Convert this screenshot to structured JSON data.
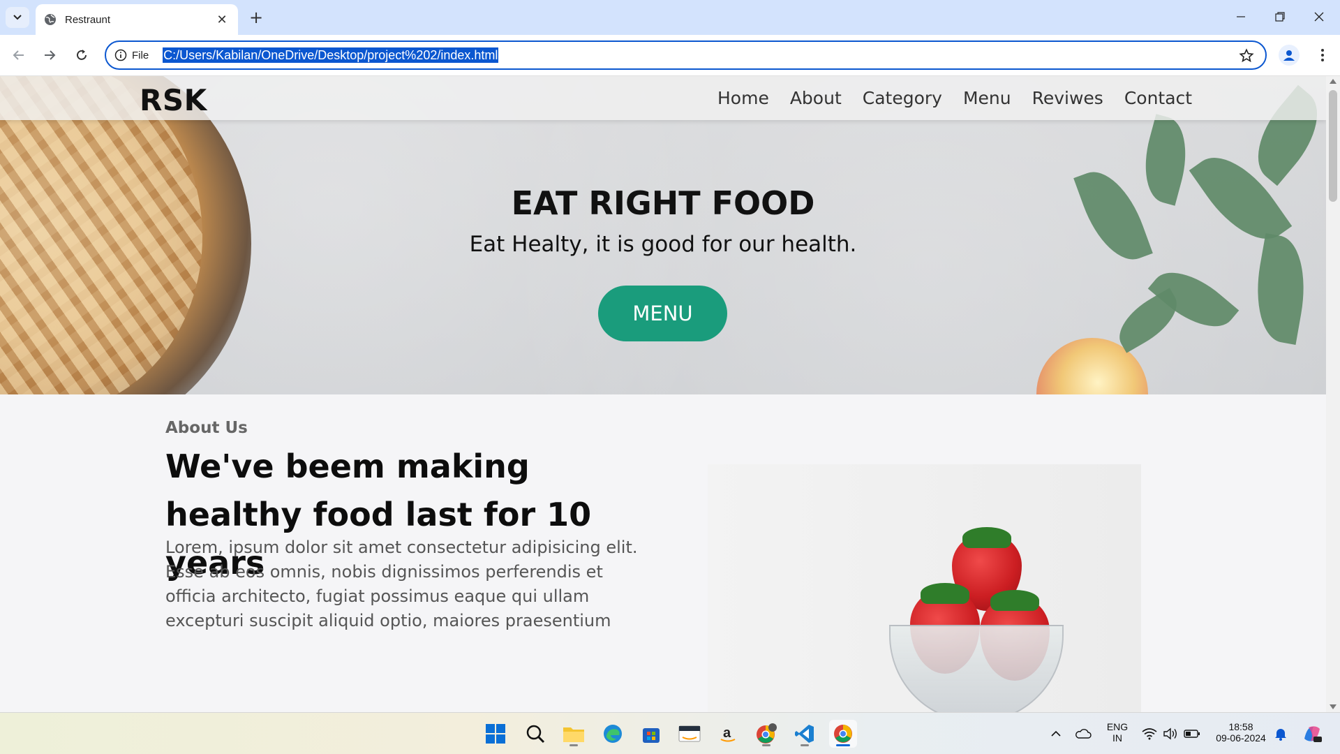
{
  "browser": {
    "tab_title": "Restraunt",
    "omnibox_chip": "File",
    "url": "C:/Users/Kabilan/OneDrive/Desktop/project%202/index.html"
  },
  "site": {
    "logo": "RSK",
    "nav": [
      "Home",
      "About",
      "Category",
      "Menu",
      "Reviwes",
      "Contact"
    ],
    "hero": {
      "title": "EAT RIGHT FOOD",
      "subtitle": "Eat Healty, it is good for our health.",
      "button": "MENU"
    },
    "about": {
      "eyebrow": "About Us",
      "heading": "We've beem making healthy food last for 10 years",
      "text": "Lorem, ipsum dolor sit amet consectetur adipisicing elit. Esse ab eos omnis, nobis dignissimos perferendis et officia architecto, fugiat possimus eaque qui ullam excepturi suscipit aliquid optio, maiores praesentium"
    }
  },
  "taskbar": {
    "apps": [
      "start-icon",
      "search-icon",
      "file-explorer-icon",
      "edge-icon",
      "microsoft-store-icon",
      "amazon-icon",
      "amazon-a-icon",
      "chrome-profile-icon",
      "vscode-icon",
      "chrome-icon"
    ],
    "language_top": "ENG",
    "language_bottom": "IN",
    "time": "18:58",
    "date": "09-06-2024"
  },
  "colors": {
    "accent_button": "#1a9c7c",
    "omnibox_focus": "#0b57d0",
    "tabstrip": "#d3e3fd"
  }
}
